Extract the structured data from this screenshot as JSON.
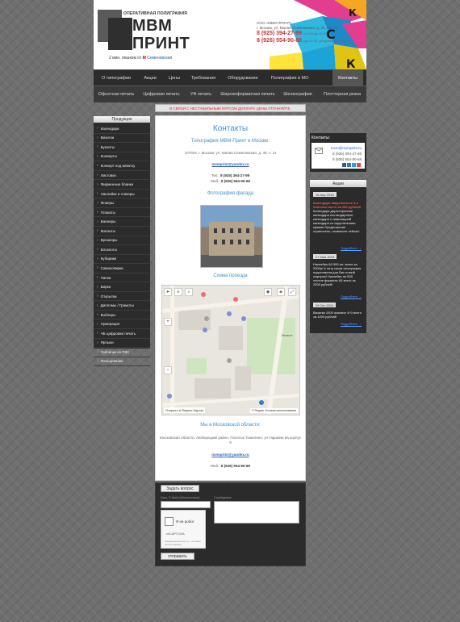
{
  "header": {
    "brand_small": "ОПЕРАТИВНАЯ ПОЛИГРАФИЯ",
    "brand_line1": "МВМ",
    "brand_line2": "ПРИНТ",
    "sub_prefix": "2 мин. пешком от",
    "metro_letter": "М",
    "metro_station": "Семеновская",
    "contact_line1": "ООО «МВМ ПРИНТ»",
    "contact_line2": "г. Москва, ул. Малая Семеновская, д. 30, стр. 11",
    "phone1": "8 (925) 394-27-99",
    "phone1_note": "(с 9:00 до 19:00)",
    "phone2": "8 (926) 554-90-68",
    "phone2_note": "(до 22:00, дежурный менеджер)"
  },
  "nav1": [
    "О типографии",
    "Акции",
    "Цены",
    "Требования",
    "Оборудование",
    "Полиграфия в МО",
    "Контакты"
  ],
  "nav2": [
    "Офсетная печать",
    "Цифровая печать",
    "УФ печать",
    "Широкоформатная печать",
    "Шелкография",
    "Плоттерная резка"
  ],
  "warning": "В СВЯЗИ С НЕСТАБИЛЬНЫМ КУРСОМ ДОЛЛАРА ЦЕНЫ УТОЧНЯЙТЕ.",
  "sidebar": {
    "title": "Продукция",
    "items": [
      "Календари",
      "Визитки",
      "Буклеты",
      "Конверты",
      "Конверт под визитку",
      "Листовки",
      "Фирменные бланки",
      "Наклейки и стикеры",
      "Флаеры",
      "Плакаты",
      "Баннеры",
      "Магниты",
      "Брошюры",
      "Блокноты",
      "Кубарики",
      "Самокопирки",
      "Папки",
      "Бирки",
      "Открытки",
      "Дипломы / Грамоты",
      "Воблеры",
      "Нумерация",
      "ЧБ цифровая печать",
      "Ярлыки",
      "Таблички из ПВХ",
      "Фальцевание"
    ]
  },
  "main": {
    "title": "Контакты",
    "office_title": "Типография МВМ-Принт в Москве:",
    "address": "107023, г. Москва, ул. Малая Семеновская, д. 30, с. 11",
    "email": "mvmprint@yandex.ru",
    "tel_label": "Тел.:",
    "tel": "8 (925) 394-27-99",
    "mob_label": "Моб.:",
    "mob": "8 (926) 554-90-68",
    "photo_title": "Фотография фасада",
    "map_title": "Схема проезда",
    "map_footer": "Открыть в Яндекс Картах",
    "map_footer2": "© Яндекс Условия использования",
    "region_title": "Мы в Московской области:",
    "region_address": "Московская область, Люберецкий район, Поселок Томилино, ул Гаршина 9а корпус 9",
    "region_email": "mvmprint@yandex.ru",
    "region_mob_label": "Моб.:",
    "region_mob": "8 (926) 554-90-68"
  },
  "contacts_box": {
    "title": "Контакты:",
    "email": "mvm@mvmprint.ru",
    "phone1": "8 (925) 394-27-99",
    "phone2": "8 (926) 554-90-68"
  },
  "promos": {
    "title": "Акции",
    "items": [
      {
        "date": "16 Апр 2018",
        "red": "Календари квартальные 3-х блочные всего за 250 рублей!",
        "text": "Календари двухсторонние календари постандартные календари с ламинацией календари со скругленными краями Предложение ограничено, позвоните сейчас!",
        "more": "Подробнее →"
      },
      {
        "date": "27 Мая 2015",
        "red": "",
        "text": "Наклейка А5 500 шт. всего за 2500р! К лету наша типография подготовила для Вас новый сюрприз! Наклейки на 500 листов формата А5 всего за 2500 рублей!",
        "more": "Подробнее →"
      },
      {
        "date": "29 Окт 2014",
        "red": "",
        "text": "Визитки 1000 экземпл 4+0 всего за 1400 рублей!",
        "more": "Подробнее →"
      }
    ]
  },
  "form": {
    "toggle_label": "Задать вопрос",
    "name_label": "Имя, E-Mail (обязательно)",
    "message_label": "Сообщение",
    "captcha_label": "Я не робот",
    "captcha_brand": "reCAPTCHA",
    "captcha_small": "Конфиденциальность - Условия использования",
    "submit_label": "отправить"
  }
}
